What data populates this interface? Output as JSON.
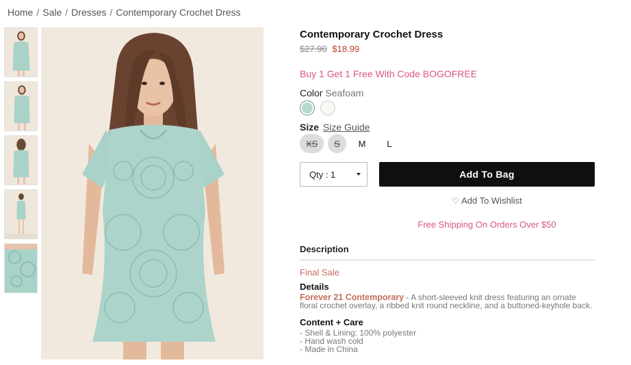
{
  "breadcrumb": {
    "items": [
      "Home",
      "Sale",
      "Dresses",
      "Contemporary Crochet Dress"
    ],
    "separator": "/"
  },
  "product": {
    "title": "Contemporary Crochet Dress",
    "price_original": "$27.90",
    "price_sale": "$18.99",
    "promo": "Buy 1 Get 1 Free With Code BOGOFREE",
    "color_label": "Color",
    "color_value": "Seafoam",
    "swatches": [
      {
        "name": "Seafoam",
        "hex": "#b8d9cf",
        "selected": true
      },
      {
        "name": "White",
        "hex": "#f7f7f3",
        "selected": false
      }
    ],
    "size_label": "Size",
    "size_guide": "Size Guide",
    "sizes": [
      {
        "label": "XS",
        "available": false
      },
      {
        "label": "S",
        "available": false
      },
      {
        "label": "M",
        "available": true
      },
      {
        "label": "L",
        "available": true
      }
    ],
    "qty_label": "Qty : 1",
    "add_to_bag": "Add To Bag",
    "wishlist": "Add To Wishlist",
    "shipping": "Free Shipping On Orders Over $50"
  },
  "description": {
    "heading": "Description",
    "final_sale": "Final Sale",
    "details_heading": "Details",
    "brand": "Forever 21 Contemporary",
    "details_text": " - A short-sleeved knit dress featuring an ornate floral crochet overlay, a ribbed knit round neckline, and a buttoned-keyhole back.",
    "care_heading": "Content + Care",
    "care_items": [
      "- Shell & Lining: 100% polyester",
      "- Hand wash cold",
      "- Made in China"
    ]
  },
  "icons": {
    "heart": "heart-outline-icon",
    "caret": "caret-down-icon"
  },
  "colors": {
    "promo": "#d9567d",
    "sale_price": "#c0392b",
    "brand": "#c56e5b",
    "button": "#0f0f0f"
  }
}
